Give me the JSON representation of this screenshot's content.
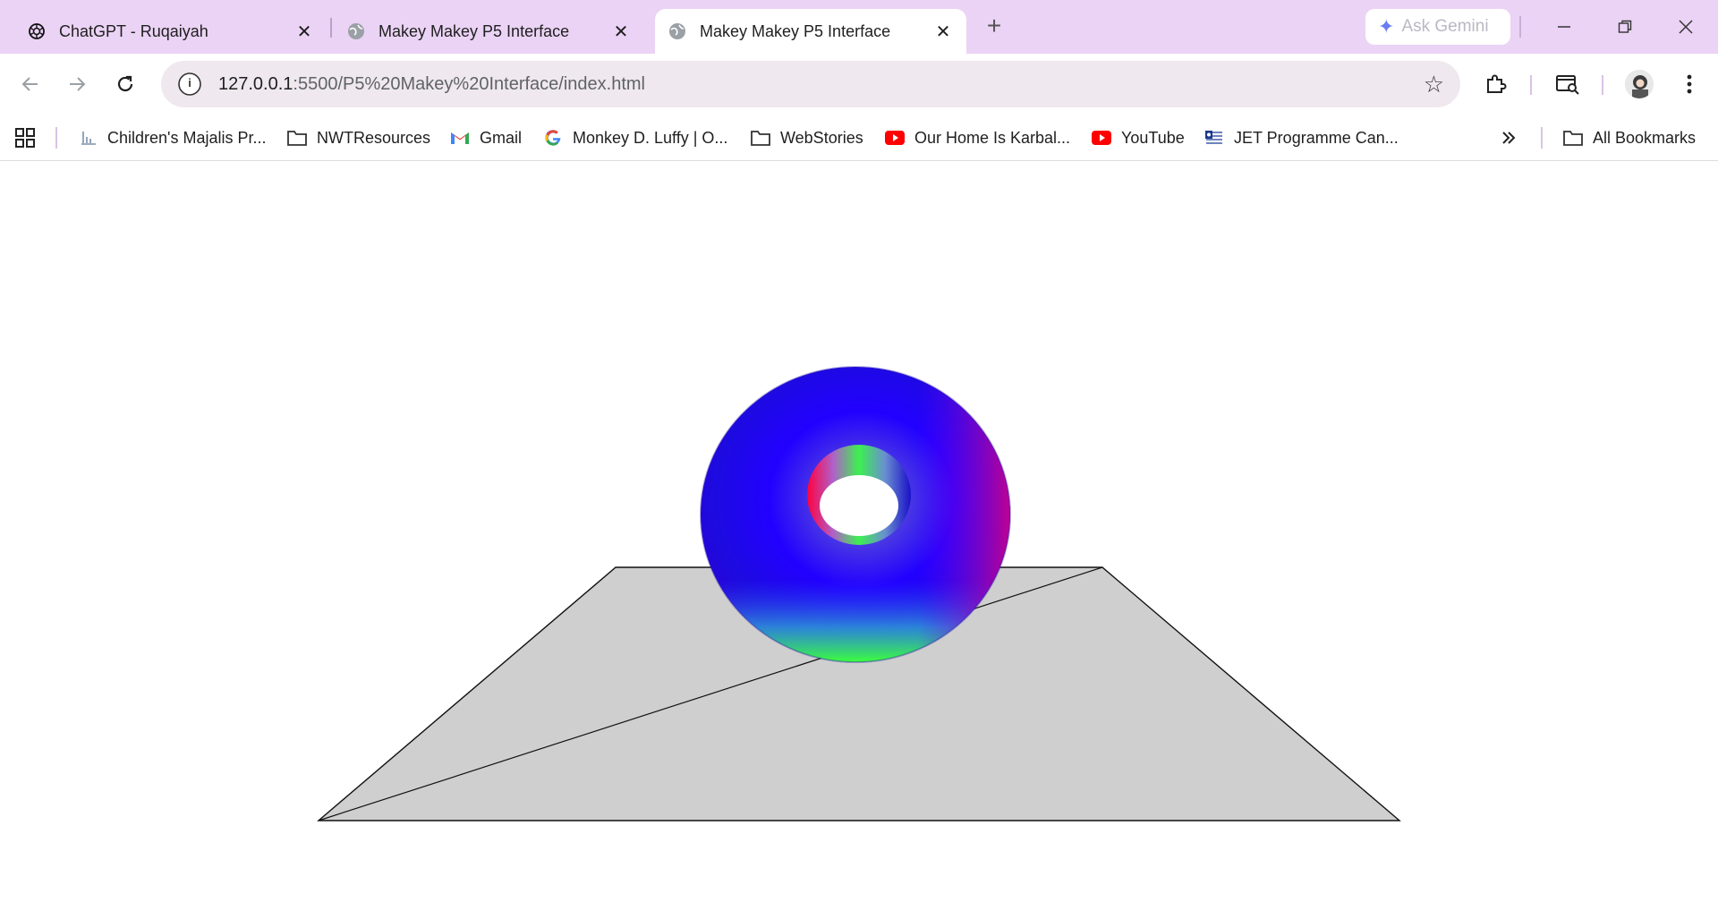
{
  "tabs": [
    {
      "title": "ChatGPT - Ruqaiyah",
      "icon": "chatgpt-icon",
      "active": false
    },
    {
      "title": "Makey Makey P5 Interface",
      "icon": "globe-icon",
      "active": false
    },
    {
      "title": "Makey Makey P5 Interface",
      "icon": "globe-icon",
      "active": true
    }
  ],
  "gemini": {
    "label": "Ask Gemini"
  },
  "address": {
    "host": "127.0.0.1",
    "path": ":5500/P5%20Makey%20Interface/index.html"
  },
  "bookmarks": [
    {
      "label": "Children's Majalis Pr...",
      "icon": "page-icon"
    },
    {
      "label": "NWTResources",
      "icon": "folder-icon"
    },
    {
      "label": "Gmail",
      "icon": "gmail-icon"
    },
    {
      "label": "Monkey D. Luffy | O...",
      "icon": "google-icon"
    },
    {
      "label": "WebStories",
      "icon": "folder-icon"
    },
    {
      "label": "Our Home Is Karbal...",
      "icon": "youtube-icon"
    },
    {
      "label": "YouTube",
      "icon": "youtube-icon"
    },
    {
      "label": "JET Programme Can...",
      "icon": "jet-icon"
    }
  ],
  "all_bookmarks": {
    "label": "All Bookmarks"
  },
  "colors": {
    "tabstrip": "#ebd3f5",
    "plane": "#cfcfcf",
    "omnibox": "#efe8ee"
  }
}
